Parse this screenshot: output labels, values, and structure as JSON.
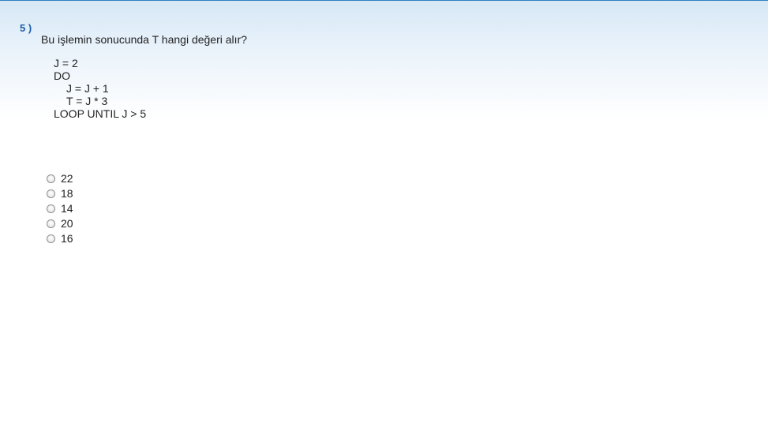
{
  "question": {
    "number": "5 )",
    "text": "Bu işlemin sonucunda T hangi değeri alır?"
  },
  "code": {
    "lines": [
      "J = 2",
      "DO",
      "J = J + 1",
      "T = J * 3",
      "LOOP UNTIL J > 5"
    ]
  },
  "options": [
    "22",
    "18",
    "14",
    "20",
    "16"
  ],
  "colors": {
    "accent": "#1a5ea8",
    "top_border": "#2d7fc0"
  }
}
